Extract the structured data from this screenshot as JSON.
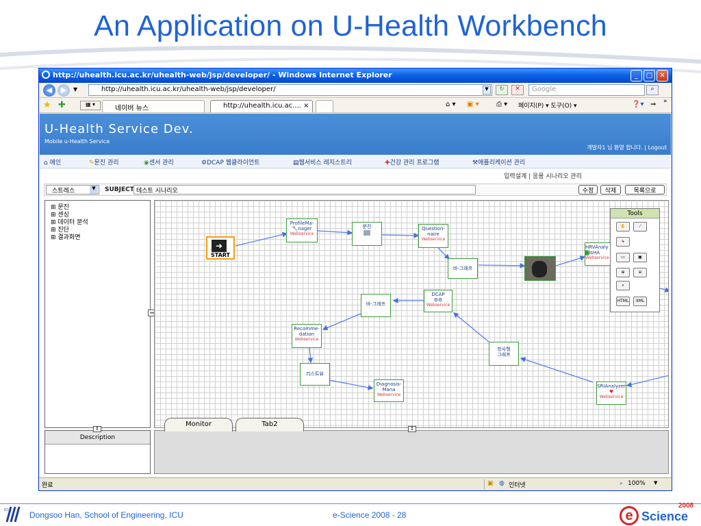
{
  "slide": {
    "title": "An Application on U-Health Workbench",
    "footer_left": "Dongsoo Han, School of Engineering, ICU",
    "footer_mid": "e-Science  2008 - 28",
    "logo_year": "2008",
    "logo_text": "Science"
  },
  "browser": {
    "window_title": "http://uhealth.icu.ac.kr/uhealth-web/jsp/developer/ - Windows Internet Explorer",
    "address": "http://uhealth.icu.ac.kr/uhealth-web/jsp/developer/",
    "search_placeholder": "Google",
    "tabs": [
      "네이버 뉴스",
      "http://uhealth.icu.ac....  ×"
    ],
    "toolbar_right": "페이지(P) ▾  도구(O) ▾",
    "status_left": "완료",
    "status_zone": "인터넷",
    "status_zoom": "100%"
  },
  "site": {
    "title": "U-Health Service Dev.",
    "subtitle": "Mobile u-Health Service",
    "welcome": "개발자1 님 환영 합니다. | Logout",
    "nav": [
      "메인",
      "문진 관리",
      "센서 관리",
      "DCAP 웹클라이언트",
      "웹서비스 레지스트리",
      "건강 관리 프로그램",
      "애플리케이션 관리"
    ],
    "breadcrumb": "입력설계 | 응용 시나리오 관리",
    "select_value": "스트레스",
    "subject_label": "SUBJECT",
    "subject_value": "테스트 시나리오",
    "btn_edit": "수정",
    "btn_delete": "삭제",
    "btn_list": "목록으로",
    "tree": [
      "문진",
      "센싱",
      "데이터 분석",
      "진단",
      "결과화면"
    ],
    "description_label": "Description",
    "bottom_tabs": [
      "Monitor",
      "Tab2"
    ]
  },
  "workflow": {
    "start": "START",
    "profile": [
      "ProfileMa-",
      "nager"
    ],
    "munjin": "문진",
    "question": [
      "Question-",
      "naire"
    ],
    "bar1": "바-그래프",
    "hrv": [
      "HRVAnaly",
      "isHA"
    ],
    "dcap": "DCAP",
    "bar2": "바-그래프",
    "recommend": [
      "Recomme-",
      "dation"
    ],
    "bangsa": [
      "방사형",
      "그래프"
    ],
    "list": "리스트뷰",
    "diagnosis": [
      "Diagnosis-",
      "Mana"
    ],
    "sri": "SRIAnalyzer",
    "webservice": "Webservice",
    "tools_title": "Tools"
  }
}
